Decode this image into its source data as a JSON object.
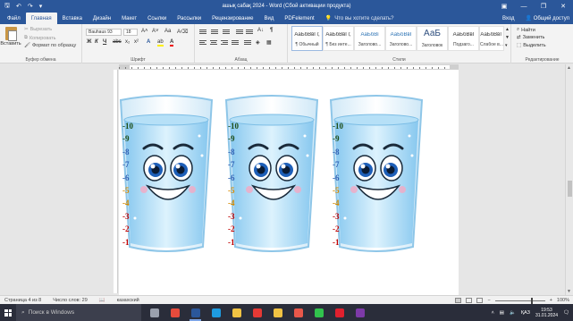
{
  "window": {
    "title": "ашық сабақ 2024 - Word (Сбой активации продукта)",
    "controls": [
      "—",
      "❐",
      "✕"
    ],
    "qat_icons": [
      "save-icon",
      "undo-icon",
      "redo-icon",
      "customize-icon"
    ]
  },
  "tabs": [
    "Файл",
    "Главная",
    "Вставка",
    "Дизайн",
    "Макет",
    "Ссылки",
    "Рассылки",
    "Рецензирование",
    "Вид",
    "PDFelement"
  ],
  "active_tab": "Главная",
  "tell_me": "Что вы хотите сделать?",
  "account": {
    "signin": "Вход",
    "share": "Общий доступ"
  },
  "clipboard": {
    "paste": "Вставить",
    "cut": "Вырезать",
    "copy": "Копировать",
    "format_painter": "Формат по образцу",
    "label": "Буфер обмена"
  },
  "font": {
    "name": "Bauhaus 93",
    "size": "18",
    "label": "Шрифт",
    "bold": "Ж",
    "italic": "К",
    "underline": "Ч",
    "strike": "abc",
    "sub": "x₂",
    "sup": "x²"
  },
  "paragraph": {
    "label": "Абзац"
  },
  "styles": {
    "label": "Стили",
    "items": [
      {
        "sample": "АаБбВвГг,",
        "name": "¶ Обычный",
        "selected": true
      },
      {
        "sample": "АаБбВвГг,",
        "name": "¶ Без инте...",
        "selected": false
      },
      {
        "sample": "АаБбВі",
        "name": "Заголово...",
        "selected": false,
        "blue": true
      },
      {
        "sample": "АаБбВвІ",
        "name": "Заголово...",
        "selected": false,
        "blue": true
      },
      {
        "sample": "АаБ",
        "name": "Заголовок",
        "selected": false,
        "big": true
      },
      {
        "sample": "АаБбВвІ",
        "name": "Подзаго...",
        "selected": false
      },
      {
        "sample": "АаБбВвГ",
        "name": "Слабое в...",
        "selected": false
      }
    ]
  },
  "editing": {
    "label": "Редактирование",
    "find": "Найти",
    "replace": "Заменить",
    "select": "Выделить"
  },
  "scale_labels": [
    {
      "text": "-10",
      "color": "#1f4e18"
    },
    {
      "text": "-9",
      "color": "#1f4e18"
    },
    {
      "text": "-8",
      "color": "#2f5fb3"
    },
    {
      "text": "-7",
      "color": "#2f5fb3"
    },
    {
      "text": "-6",
      "color": "#2f5fb3"
    },
    {
      "text": "-5",
      "color": "#d58a00"
    },
    {
      "text": "-4",
      "color": "#d58a00"
    },
    {
      "text": "-3",
      "color": "#c00000"
    },
    {
      "text": "-2",
      "color": "#c00000"
    },
    {
      "text": "-1",
      "color": "#c00000"
    }
  ],
  "status": {
    "page": "Страница 4 из 8",
    "words": "Число слов: 29",
    "language": "казахский",
    "zoom": "100%"
  },
  "taskbar": {
    "search": "Поиск в Windows",
    "icons": [
      {
        "name": "task-view-icon",
        "color": "#9aa0ad"
      },
      {
        "name": "yandex-browser-icon",
        "color": "#e74b3c"
      },
      {
        "name": "word-icon",
        "color": "#2b579a",
        "active": true
      },
      {
        "name": "edge-icon",
        "color": "#1e9be0"
      },
      {
        "name": "file-explorer-icon",
        "color": "#f0c243"
      },
      {
        "name": "yandex-icon",
        "color": "#e53935"
      },
      {
        "name": "folder-icon",
        "color": "#f0c243"
      },
      {
        "name": "mail-icon",
        "color": "#e8574a"
      },
      {
        "name": "whatsapp-icon",
        "color": "#31c24d"
      },
      {
        "name": "opera-icon",
        "color": "#e0202e"
      },
      {
        "name": "onenote-icon",
        "color": "#7d3aa8"
      }
    ],
    "lang": "ҚАЗ",
    "time": "19:53",
    "date": "31.01.2024"
  }
}
